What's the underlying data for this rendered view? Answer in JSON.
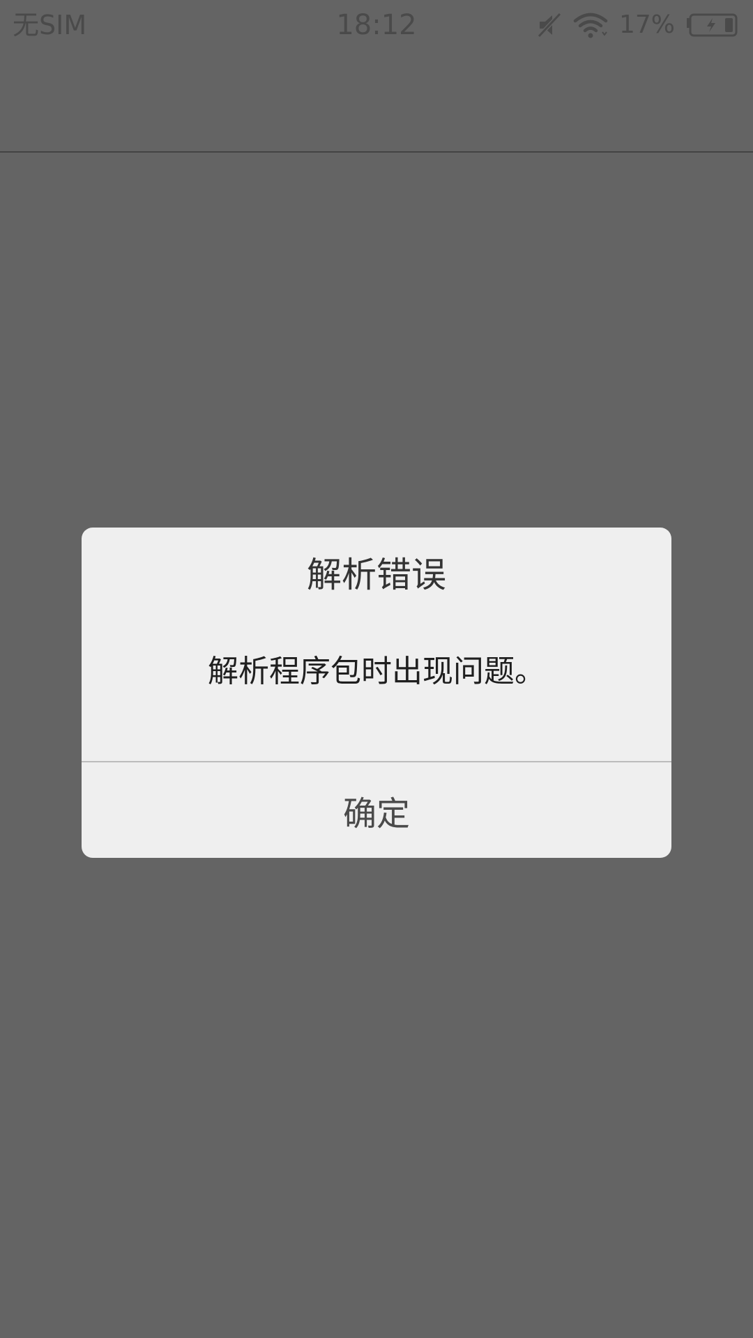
{
  "status_bar": {
    "carrier": "无SIM",
    "time": "18:12",
    "battery_percent": "17%",
    "icons": [
      "mute-icon",
      "wifi-icon",
      "battery-charging-icon"
    ]
  },
  "dialog": {
    "title": "解析错误",
    "message": "解析程序包时出现问题。",
    "confirm_label": "确定"
  },
  "colors": {
    "scrim": "#646464",
    "dialog_bg": "#efefef",
    "status_text": "#4a4a4a"
  }
}
